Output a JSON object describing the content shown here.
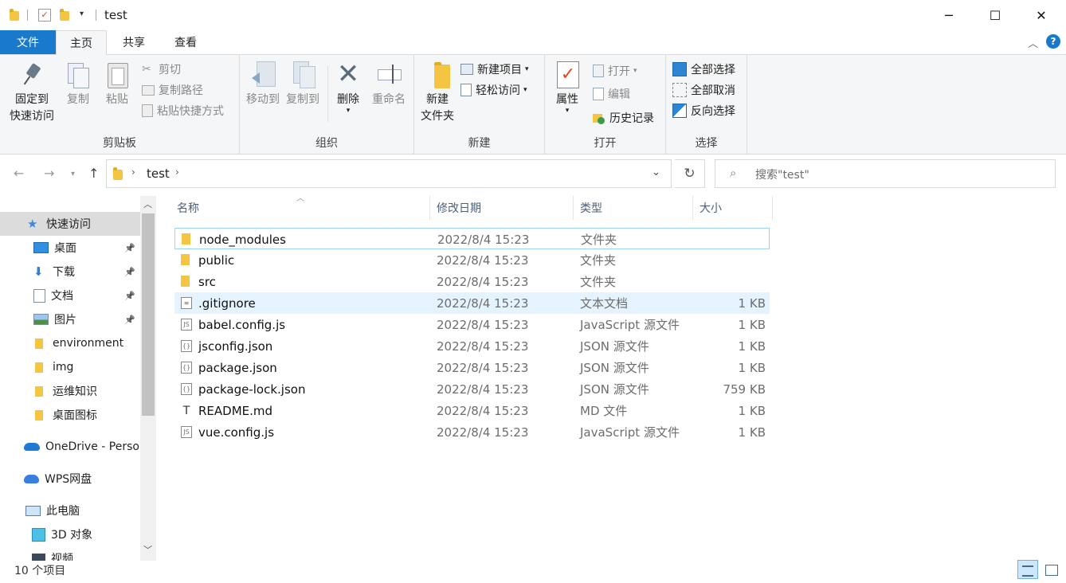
{
  "window": {
    "title": "test",
    "minimize": "─",
    "maximize": "☐",
    "close": "✕"
  },
  "ribbon_tabs": {
    "file": "文件",
    "home": "主页",
    "share": "共享",
    "view": "查看"
  },
  "ribbon": {
    "clipboard": {
      "label": "剪贴板",
      "pin_quick_access": [
        "固定到",
        "快速访问"
      ],
      "copy": "复制",
      "paste": "粘贴",
      "cut": "剪切",
      "copy_path": "复制路径",
      "paste_shortcut": "粘贴快捷方式"
    },
    "organize": {
      "label": "组织",
      "move_to": "移动到",
      "copy_to": "复制到",
      "delete": "删除",
      "rename": "重命名"
    },
    "new": {
      "label": "新建",
      "new_folder": [
        "新建",
        "文件夹"
      ],
      "new_item": "新建项目",
      "easy_access": "轻松访问"
    },
    "open": {
      "label": "打开",
      "properties": "属性",
      "open": "打开",
      "edit": "编辑",
      "history": "历史记录"
    },
    "select": {
      "label": "选择",
      "select_all": "全部选择",
      "select_none": "全部取消",
      "invert": "反向选择"
    }
  },
  "address": {
    "crumb": "test",
    "search_placeholder": "搜索\"test\""
  },
  "nav_pane": {
    "items": [
      {
        "label": "快速访问",
        "icon": "star-icon",
        "pinned": false
      },
      {
        "label": "桌面",
        "icon": "desktop-icon",
        "pinned": true
      },
      {
        "label": "下载",
        "icon": "download-icon",
        "pinned": true
      },
      {
        "label": "文档",
        "icon": "document-icon",
        "pinned": true
      },
      {
        "label": "图片",
        "icon": "picture-icon",
        "pinned": true
      },
      {
        "label": "environment",
        "icon": "folder-icon",
        "pinned": false
      },
      {
        "label": "img",
        "icon": "folder-icon",
        "pinned": false
      },
      {
        "label": "运维知识",
        "icon": "folder-icon",
        "pinned": false
      },
      {
        "label": "桌面图标",
        "icon": "folder-icon",
        "pinned": false
      },
      {
        "label": "OneDrive - Personal",
        "icon": "onedrive-icon",
        "pinned": false
      },
      {
        "label": "WPS网盘",
        "icon": "wps-cloud-icon",
        "pinned": false
      },
      {
        "label": "此电脑",
        "icon": "computer-icon",
        "pinned": false
      },
      {
        "label": "3D 对象",
        "icon": "3d-objects-icon",
        "pinned": false
      },
      {
        "label": "视频",
        "icon": "video-icon",
        "pinned": false
      }
    ]
  },
  "columns": {
    "name": "名称",
    "date": "修改日期",
    "type": "类型",
    "size": "大小"
  },
  "files": [
    {
      "name": "node_modules",
      "date": "2022/8/4 15:23",
      "type": "文件夹",
      "size": "",
      "icon": "folder-icon"
    },
    {
      "name": "public",
      "date": "2022/8/4 15:23",
      "type": "文件夹",
      "size": "",
      "icon": "folder-icon"
    },
    {
      "name": "src",
      "date": "2022/8/4 15:23",
      "type": "文件夹",
      "size": "",
      "icon": "folder-icon"
    },
    {
      "name": ".gitignore",
      "date": "2022/8/4 15:23",
      "type": "文本文档",
      "size": "1 KB",
      "icon": "text-file-icon"
    },
    {
      "name": "babel.config.js",
      "date": "2022/8/4 15:23",
      "type": "JavaScript 源文件",
      "size": "1 KB",
      "icon": "js-file-icon"
    },
    {
      "name": "jsconfig.json",
      "date": "2022/8/4 15:23",
      "type": "JSON 源文件",
      "size": "1 KB",
      "icon": "json-file-icon"
    },
    {
      "name": "package.json",
      "date": "2022/8/4 15:23",
      "type": "JSON 源文件",
      "size": "1 KB",
      "icon": "json-file-icon"
    },
    {
      "name": "package-lock.json",
      "date": "2022/8/4 15:23",
      "type": "JSON 源文件",
      "size": "759 KB",
      "icon": "json-file-icon"
    },
    {
      "name": "README.md",
      "date": "2022/8/4 15:23",
      "type": "MD 文件",
      "size": "1 KB",
      "icon": "md-file-icon"
    },
    {
      "name": "vue.config.js",
      "date": "2022/8/4 15:23",
      "type": "JavaScript 源文件",
      "size": "1 KB",
      "icon": "js-file-icon"
    }
  ],
  "status": {
    "count": "10 个项目"
  },
  "colors": {
    "accent": "#1979ca",
    "folder": "#f4c542",
    "selected_row": "#e5f3ff",
    "focus_border": "#99d1ff"
  }
}
